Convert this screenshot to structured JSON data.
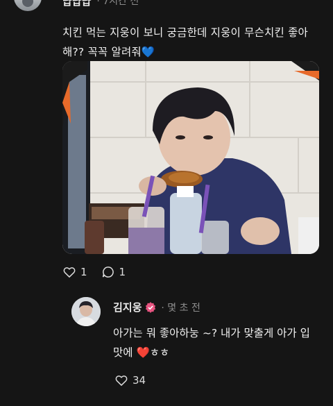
{
  "post": {
    "author": "냡냡냡",
    "time": "· 7시간 전",
    "text_main": "치킨 먹는 지웅이 보니 궁금한데 지웅이 무슨치킨 좋아해?? 꼭꼭 알려줘",
    "text_emoji": "💙",
    "image_alt": "photo-of-person-eating-chicken",
    "like_count": "1",
    "comment_count": "1"
  },
  "reply": {
    "author": "김지웅",
    "time": "· 몇 초 전",
    "text_main": "아가는 뭐 좋아하눙 ~? 내가 맞출게 아가 입맛에 ",
    "text_heart": "❤️",
    "text_tail": "ㅎㅎ",
    "like_count": "34"
  },
  "colors": {
    "background": "#151515",
    "text": "#f0f0f0",
    "muted": "#8a8a8a",
    "blue_heart": "#3b82f6",
    "red_heart": "#e0223b",
    "badge": "#e75480"
  },
  "icons": [
    "heart-outline-icon",
    "comment-bubble-icon",
    "verified-badge-icon"
  ]
}
